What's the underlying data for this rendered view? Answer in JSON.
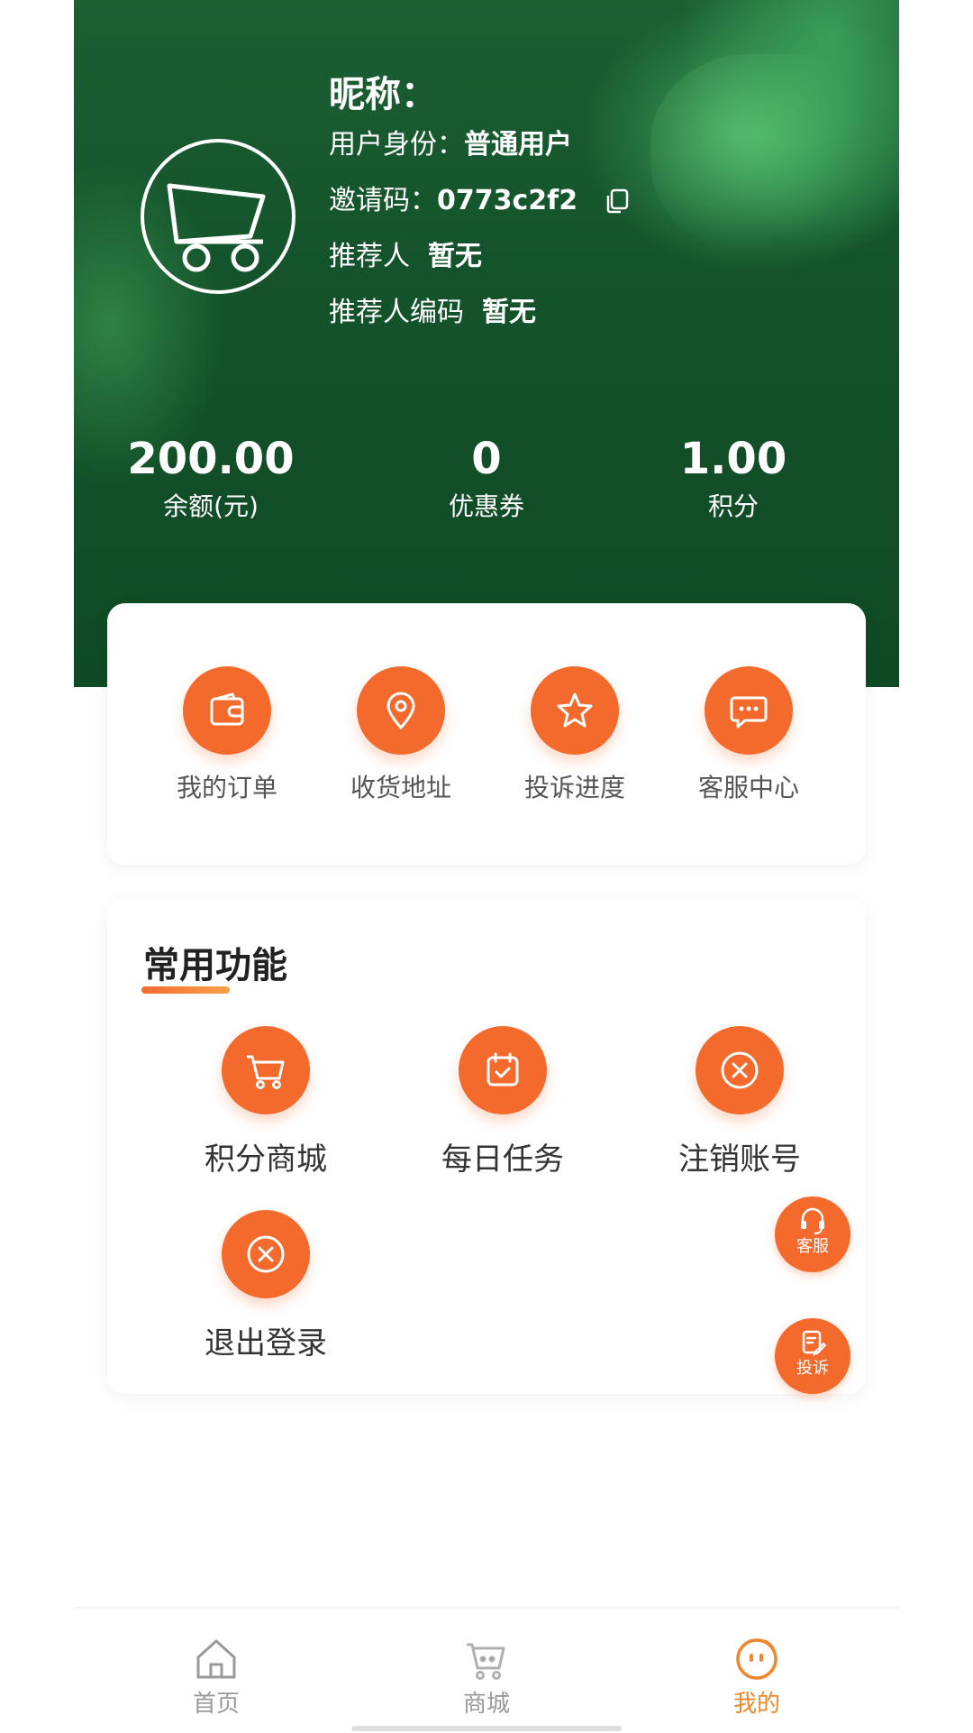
{
  "profile": {
    "nickname_label": "昵称：",
    "identity_label": "用户身份：",
    "identity_value": "普通用户",
    "invite_label": "邀请码：",
    "invite_code": "0773c2f2",
    "referrer_label": "推荐人",
    "referrer_value": "暂无",
    "referrer_code_label": "推荐人编码",
    "referrer_code_value": "暂无"
  },
  "stats": [
    {
      "value": "200.00",
      "label": "余额(元)"
    },
    {
      "value": "0",
      "label": "优惠券"
    },
    {
      "value": "1.00",
      "label": "积分"
    }
  ],
  "quick_actions": [
    {
      "label": "我的订单",
      "icon": "wallet-icon"
    },
    {
      "label": "收货地址",
      "icon": "location-pin-icon"
    },
    {
      "label": "投诉进度",
      "icon": "star-icon"
    },
    {
      "label": "客服中心",
      "icon": "chat-bubble-icon"
    }
  ],
  "common": {
    "title": "常用功能",
    "items": [
      {
        "label": "积分商城",
        "icon": "cart-icon"
      },
      {
        "label": "每日任务",
        "icon": "calendar-check-icon"
      },
      {
        "label": "注销账号",
        "icon": "close-circle-icon"
      },
      {
        "label": "退出登录",
        "icon": "close-circle-icon"
      }
    ]
  },
  "floating": {
    "service_label": "客服",
    "complaint_label": "投诉"
  },
  "nav": [
    {
      "label": "首页",
      "icon": "home-icon"
    },
    {
      "label": "商城",
      "icon": "cart-icon"
    },
    {
      "label": "我的",
      "icon": "face-icon"
    }
  ],
  "colors": {
    "accent": "#f46a2d",
    "header_green": "#14532b",
    "nav_active": "#f0872d"
  }
}
